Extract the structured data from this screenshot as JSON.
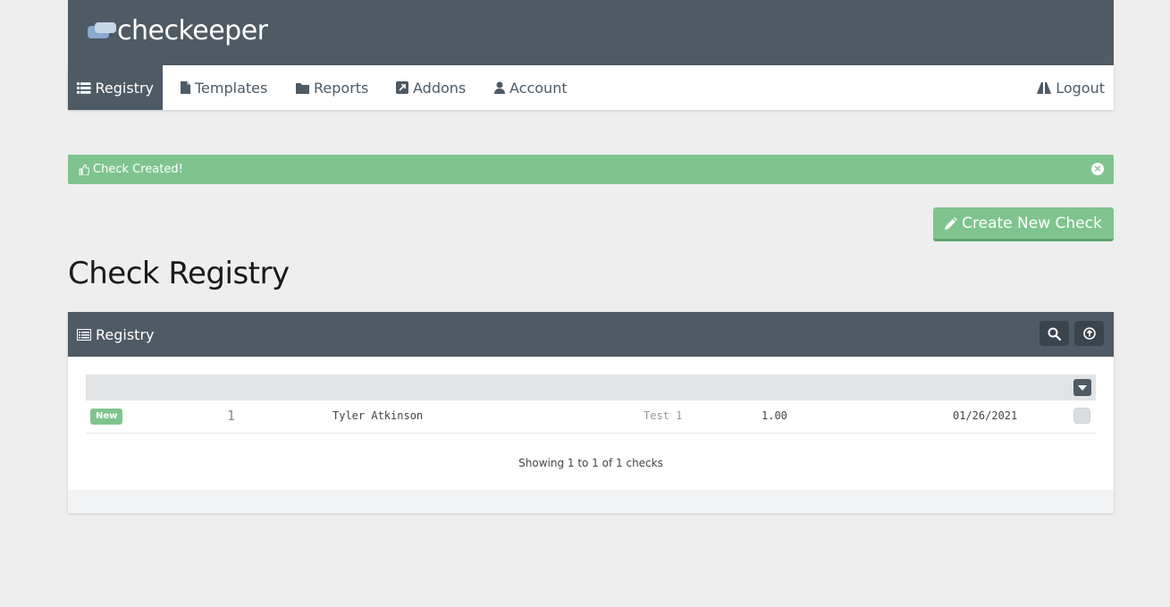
{
  "brand": {
    "name": "checkeeper"
  },
  "nav": {
    "items": [
      {
        "label": "Registry",
        "icon": "list-icon",
        "active": true
      },
      {
        "label": "Templates",
        "icon": "file-icon"
      },
      {
        "label": "Reports",
        "icon": "folder-icon"
      },
      {
        "label": "Addons",
        "icon": "external-link-icon"
      },
      {
        "label": "Account",
        "icon": "user-icon"
      }
    ],
    "logout": {
      "label": "Logout",
      "icon": "road-icon"
    }
  },
  "alert": {
    "text": "Check Created!",
    "icon": "thumbs-up-icon",
    "close_icon": "close-circle-icon"
  },
  "create_button": {
    "label": "Create New Check",
    "icon": "pencil-icon"
  },
  "page_title": "Check Registry",
  "panel": {
    "title": "Registry",
    "icon": "registry-icon",
    "actions": [
      {
        "icon": "search-icon"
      },
      {
        "icon": "upload-circle-icon"
      }
    ]
  },
  "table": {
    "header_action_icon": "caret-down-icon",
    "rows": [
      {
        "status": "New",
        "number": "1",
        "payee": "Tyler Atkinson",
        "memo": "Test 1",
        "amount": "1.00",
        "date": "01/26/2021",
        "selected": false
      }
    ],
    "summary": "Showing 1 to 1 of 1 checks"
  },
  "colors": {
    "header_bg": "#4e5a64",
    "accent_green": "#7fc48f",
    "page_bg": "#eeeeee"
  }
}
